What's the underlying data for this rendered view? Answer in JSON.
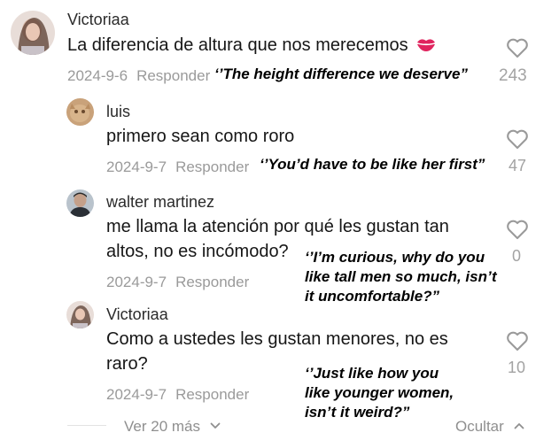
{
  "comments": [
    {
      "author": "Victoriaa",
      "text": "La diferencia de altura que nos merecemos",
      "emoji": "💋",
      "date": "2024-9-6",
      "reply_label": "Responder",
      "likes": "243",
      "translation": "‘’The height difference we deserve”"
    },
    {
      "author": "luis",
      "text": "primero sean como roro",
      "date": "2024-9-7",
      "reply_label": "Responder",
      "likes": "47",
      "translation": "‘’You’d have to be like her first”"
    },
    {
      "author": "walter martinez",
      "text_line1": "me llama la atención por qué les gustan tan",
      "text_line2": "altos, no es incómodo?",
      "date": "2024-9-7",
      "reply_label": "Responder",
      "likes": "0",
      "translation_line1": "‘’I’m curious, why do you",
      "translation_line2": "like tall men so much, isn’t",
      "translation_line3": "it uncomfortable?”"
    },
    {
      "author": "Victoriaa",
      "text_line1": "Como a ustedes les gustan menores, no es",
      "text_line2": "raro?",
      "date": "2024-9-7",
      "reply_label": "Responder",
      "likes": "10",
      "translation_line1": "‘’Just like how you",
      "translation_line2": "like younger women,",
      "translation_line3": "isn’t it weird?”"
    }
  ],
  "footer": {
    "view_more": "Ver 20 más",
    "hide": "Ocultar"
  },
  "icons": {
    "like": "heart-outline-icon",
    "expand": "chevron-down-icon",
    "collapse": "chevron-up-icon",
    "emoji": "kiss-mark-icon"
  },
  "colors": {
    "meta_gray": "#9a9a9a",
    "text": "#161616",
    "kiss": "#e0245e"
  }
}
